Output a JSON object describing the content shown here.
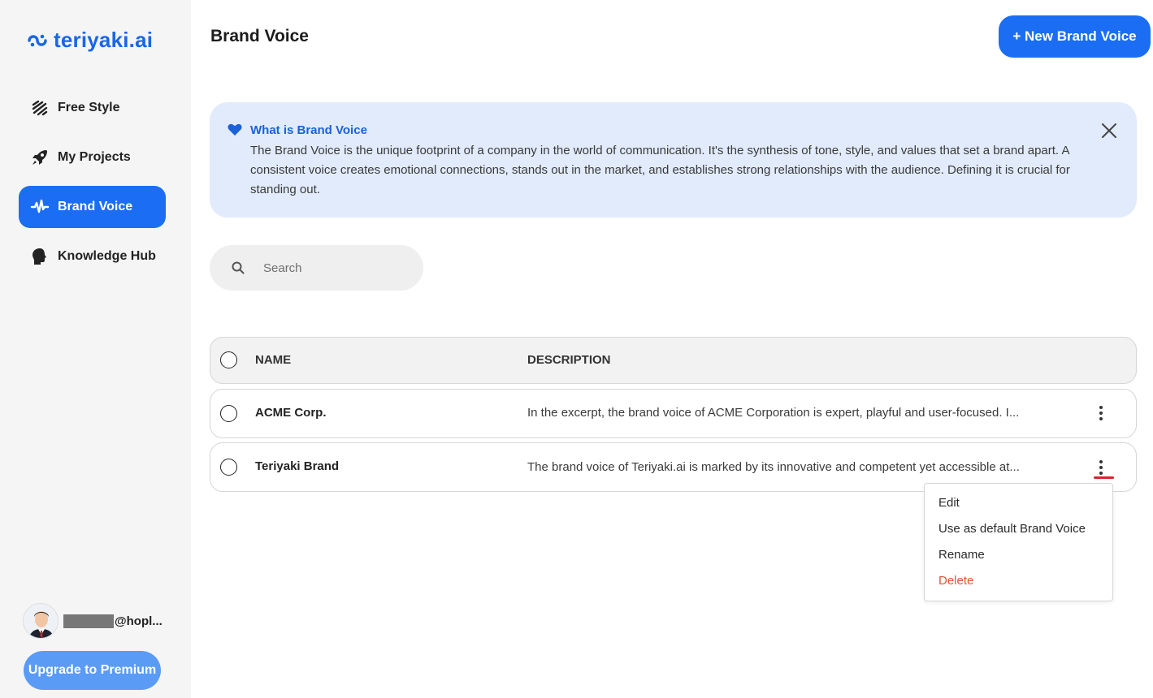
{
  "app": {
    "name": "teriyaki.ai"
  },
  "colors": {
    "accent": "#1b6ef3",
    "danger": "#e0533a",
    "info_bg": "#e1ebfb"
  },
  "sidebar": {
    "items": [
      {
        "label": "Free Style",
        "icon": "scribble-icon"
      },
      {
        "label": "My Projects",
        "icon": "rocket-icon"
      },
      {
        "label": "Brand Voice",
        "icon": "waveform-icon",
        "active": true
      },
      {
        "label": "Knowledge Hub",
        "icon": "head-icon"
      }
    ],
    "user_email": "@hopl...",
    "upgrade_label": "Upgrade to Premium"
  },
  "header": {
    "title": "Brand Voice",
    "new_button_label": "+ New Brand Voice"
  },
  "info": {
    "title": "What is Brand Voice",
    "text": "The Brand Voice is the unique footprint of a company in the world of communication. It's the synthesis of tone, style, and values that set a brand apart. A consistent voice creates emotional connections, stands out in the market, and establishes strong relationships with the audience. Defining it is crucial for standing out."
  },
  "search": {
    "placeholder": "Search"
  },
  "table": {
    "columns": [
      "NAME",
      "DESCRIPTION"
    ],
    "rows": [
      {
        "name": "ACME Corp.",
        "description": "In the excerpt, the brand voice of ACME Corporation is expert, playful and user-focused. I..."
      },
      {
        "name": "Teriyaki Brand",
        "description": "The brand voice of Teriyaki.ai is marked by its innovative and competent yet accessible at..."
      }
    ]
  },
  "context_menu": {
    "items": [
      "Edit",
      "Use as default Brand Voice",
      "Rename",
      "Delete"
    ]
  }
}
